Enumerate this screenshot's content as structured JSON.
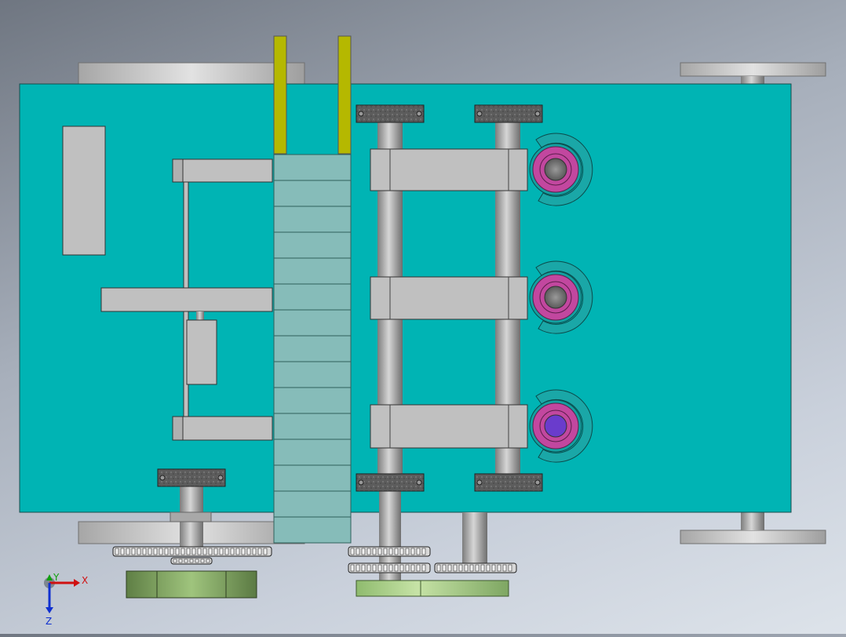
{
  "triad": {
    "x_label": "X",
    "y_label": "Y",
    "z_label": "Z"
  },
  "colors": {
    "plate": "#00b4b4",
    "plate_edge": "#1a4d4d",
    "steel": "#bfbfbf",
    "steel_dark": "#8c8c8c",
    "guide_yellow": "#b5b800",
    "slat": "#86bcb9",
    "bearing": "#5a5a5a",
    "roller_teal": "#1aa7a7",
    "roller_magenta": "#c2479f",
    "core_grey": "#7a7a7a",
    "core_purple": "#6a3ccc",
    "motor_green": "#6b8e4e",
    "motor_green_light": "#a9cf8a",
    "axis_x": "#d01010",
    "axis_y": "#10a010",
    "axis_z": "#1030d0"
  },
  "icons": {
    "triad": "coordinate-triad-icon"
  }
}
